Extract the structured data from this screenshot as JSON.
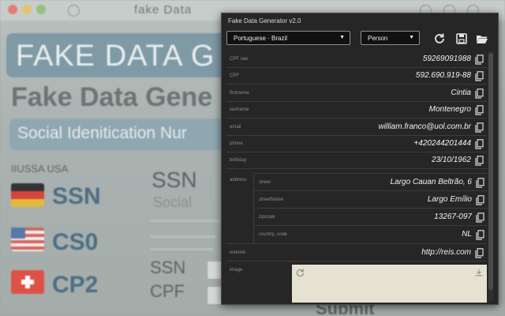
{
  "background_app": {
    "window_title": "fake Data",
    "banner": "FAKE DATA G",
    "heading": "Fake Data Gene",
    "pill": "Social Idenitication Nur",
    "small_label": "IIUSSA USA",
    "flags": [
      {
        "label": "SSN"
      },
      {
        "label": "CS0"
      },
      {
        "label": "CP2"
      }
    ],
    "form": {
      "ssn_title": "SSN",
      "social_placeholder": "Social",
      "field1_label": "SSN",
      "field2_label": "CPF",
      "submit_label": "Submit"
    }
  },
  "panel": {
    "title": "Fake Data Generator v2.0",
    "locale_select": {
      "value": "Portuguese · Brazil"
    },
    "type_select": {
      "value": "Person"
    },
    "icons": {
      "refresh": "refresh-icon",
      "save": "save-icon",
      "open": "folder-open-icon",
      "copy": "copy-icon",
      "download": "download-icon"
    },
    "fields": [
      {
        "label": "CPF raw",
        "value": "59269091988"
      },
      {
        "label": "CPF",
        "value": "592.690.919-88"
      },
      {
        "label": "firstname",
        "value": "Cintia"
      },
      {
        "label": "lastname",
        "value": "Montenegro"
      },
      {
        "label": "email",
        "value": "william.franco@uol.com.br"
      },
      {
        "label": "phone",
        "value": "+420244201444"
      },
      {
        "label": "birthday",
        "value": "23/10/1962"
      }
    ],
    "address": {
      "label": "address",
      "items": [
        {
          "label": "street",
          "value": "Largo Cauan Beltrão, 6"
        },
        {
          "label": "streetName",
          "value": "Largo Emílio"
        },
        {
          "label": "zipcode",
          "value": "13267-097"
        },
        {
          "label": "country_code",
          "value": "NL"
        }
      ]
    },
    "website": {
      "label": "website",
      "value": "http://reis.com"
    },
    "image": {
      "label": "image"
    }
  }
}
